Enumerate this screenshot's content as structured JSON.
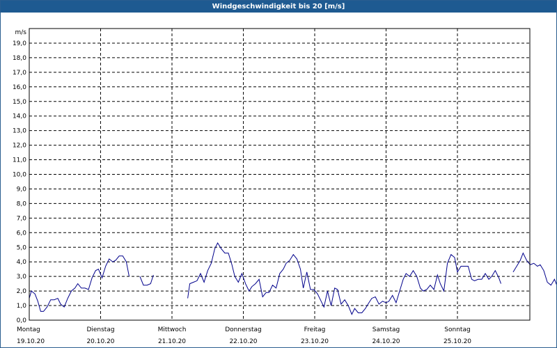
{
  "chart_data": {
    "type": "line",
    "title": "Windgeschwindigkeit bis 20 [m/s]",
    "ylabel": "m/s",
    "ylim": [
      0,
      20
    ],
    "yticks": [
      "0,0",
      "1,0",
      "2,0",
      "3,0",
      "4,0",
      "5,0",
      "6,0",
      "7,0",
      "8,0",
      "9,0",
      "10,0",
      "11,0",
      "12,0",
      "13,0",
      "14,0",
      "15,0",
      "16,0",
      "17,0",
      "18,0",
      "19,0"
    ],
    "days": [
      {
        "name": "Montag",
        "date": "19.10.20"
      },
      {
        "name": "Dienstag",
        "date": "20.10.20"
      },
      {
        "name": "Mittwoch",
        "date": "21.10.20"
      },
      {
        "name": "Donnerstag",
        "date": "22.10.20"
      },
      {
        "name": "Freitag",
        "date": "23.10.20"
      },
      {
        "name": "Samstag",
        "date": "24.10.20"
      },
      {
        "name": "Sonntag",
        "date": "25.10.20"
      }
    ],
    "grid": true,
    "line_color": "#00008b",
    "series": [
      {
        "x_unit": "day",
        "segments": [
          [
            [
              0.0,
              1.5
            ],
            [
              0.03,
              2.0
            ],
            [
              0.08,
              1.8
            ],
            [
              0.12,
              1.3
            ],
            [
              0.16,
              0.6
            ],
            [
              0.2,
              0.6
            ],
            [
              0.25,
              0.9
            ],
            [
              0.3,
              1.4
            ],
            [
              0.35,
              1.4
            ],
            [
              0.4,
              1.5
            ],
            [
              0.44,
              1.1
            ],
            [
              0.49,
              0.9
            ],
            [
              0.54,
              1.5
            ],
            [
              0.59,
              2.0
            ],
            [
              0.64,
              2.2
            ],
            [
              0.68,
              2.5
            ],
            [
              0.73,
              2.2
            ],
            [
              0.78,
              2.2
            ],
            [
              0.83,
              2.1
            ],
            [
              0.88,
              2.9
            ],
            [
              0.93,
              3.4
            ],
            [
              0.97,
              3.5
            ],
            [
              1.02,
              2.9
            ],
            [
              1.07,
              3.7
            ],
            [
              1.12,
              4.2
            ],
            [
              1.17,
              4.0
            ],
            [
              1.21,
              4.1
            ],
            [
              1.26,
              4.4
            ],
            [
              1.31,
              4.4
            ],
            [
              1.36,
              4.0
            ],
            [
              1.4,
              3.0
            ]
          ],
          [
            [
              1.55,
              3.0
            ],
            [
              1.6,
              2.4
            ],
            [
              1.65,
              2.4
            ],
            [
              1.7,
              2.5
            ],
            [
              1.74,
              3.1
            ]
          ],
          [
            [
              2.22,
              1.5
            ],
            [
              2.25,
              2.5
            ],
            [
              2.3,
              2.6
            ],
            [
              2.35,
              2.7
            ],
            [
              2.4,
              3.2
            ],
            [
              2.45,
              2.6
            ],
            [
              2.5,
              3.4
            ],
            [
              2.55,
              3.9
            ],
            [
              2.6,
              4.9
            ],
            [
              2.64,
              5.3
            ],
            [
              2.69,
              4.9
            ],
            [
              2.74,
              4.6
            ],
            [
              2.79,
              4.6
            ],
            [
              2.84,
              3.8
            ],
            [
              2.88,
              3.0
            ],
            [
              2.93,
              2.6
            ],
            [
              2.98,
              3.2
            ],
            [
              3.03,
              2.5
            ],
            [
              3.08,
              2.0
            ],
            [
              3.12,
              2.3
            ],
            [
              3.17,
              2.5
            ],
            [
              3.22,
              2.8
            ],
            [
              3.27,
              1.6
            ],
            [
              3.32,
              1.9
            ],
            [
              3.36,
              1.9
            ],
            [
              3.41,
              2.4
            ],
            [
              3.46,
              2.2
            ],
            [
              3.51,
              3.2
            ],
            [
              3.56,
              3.5
            ],
            [
              3.6,
              3.9
            ],
            [
              3.65,
              4.1
            ],
            [
              3.7,
              4.5
            ],
            [
              3.75,
              4.2
            ],
            [
              3.8,
              3.5
            ],
            [
              3.84,
              2.2
            ],
            [
              3.89,
              3.3
            ],
            [
              3.94,
              2.1
            ],
            [
              3.99,
              2.1
            ],
            [
              4.04,
              1.8
            ],
            [
              4.08,
              1.4
            ],
            [
              4.13,
              0.9
            ],
            [
              4.18,
              2.0
            ],
            [
              4.23,
              1.0
            ],
            [
              4.28,
              2.2
            ],
            [
              4.32,
              2.1
            ],
            [
              4.37,
              1.1
            ],
            [
              4.42,
              1.4
            ],
            [
              4.47,
              1.0
            ],
            [
              4.52,
              0.4
            ],
            [
              4.56,
              0.8
            ],
            [
              4.61,
              0.5
            ],
            [
              4.66,
              0.5
            ],
            [
              4.71,
              0.8
            ],
            [
              4.76,
              1.2
            ],
            [
              4.8,
              1.5
            ],
            [
              4.85,
              1.6
            ],
            [
              4.9,
              1.1
            ],
            [
              4.95,
              1.3
            ],
            [
              5.0,
              1.2
            ],
            [
              5.04,
              1.3
            ],
            [
              5.09,
              1.7
            ],
            [
              5.14,
              1.2
            ],
            [
              5.19,
              2.0
            ],
            [
              5.24,
              2.8
            ],
            [
              5.28,
              3.2
            ],
            [
              5.33,
              3.0
            ],
            [
              5.38,
              3.4
            ],
            [
              5.43,
              3.0
            ],
            [
              5.48,
              2.2
            ],
            [
              5.52,
              2.0
            ],
            [
              5.57,
              2.1
            ],
            [
              5.62,
              2.4
            ],
            [
              5.67,
              2.1
            ],
            [
              5.72,
              3.1
            ],
            [
              5.76,
              2.5
            ],
            [
              5.81,
              2.0
            ],
            [
              5.86,
              3.9
            ],
            [
              5.91,
              4.5
            ],
            [
              5.96,
              4.3
            ],
            [
              6.0,
              3.3
            ],
            [
              6.05,
              3.7
            ],
            [
              6.1,
              3.7
            ],
            [
              6.15,
              3.7
            ],
            [
              6.2,
              2.8
            ],
            [
              6.24,
              2.7
            ],
            [
              6.29,
              2.8
            ],
            [
              6.34,
              2.8
            ],
            [
              6.39,
              3.2
            ],
            [
              6.44,
              2.8
            ],
            [
              6.48,
              3.0
            ],
            [
              6.53,
              3.4
            ],
            [
              6.58,
              2.9
            ],
            [
              6.61,
              2.5
            ]
          ],
          [
            [
              6.78,
              3.3
            ],
            [
              6.83,
              3.7
            ],
            [
              6.88,
              4.1
            ],
            [
              6.92,
              4.6
            ],
            [
              6.97,
              4.1
            ],
            [
              7.02,
              3.8
            ],
            [
              7.07,
              3.9
            ],
            [
              7.12,
              3.7
            ],
            [
              7.16,
              3.8
            ],
            [
              7.21,
              3.4
            ],
            [
              7.26,
              2.6
            ],
            [
              7.31,
              2.4
            ],
            [
              7.36,
              2.8
            ],
            [
              7.4,
              2.3
            ],
            [
              7.45,
              2.0
            ],
            [
              7.5,
              1.8
            ],
            [
              7.55,
              1.4
            ],
            [
              7.6,
              1.4
            ],
            [
              7.64,
              1.9
            ],
            [
              7.69,
              2.3
            ],
            [
              7.74,
              2.2
            ],
            [
              7.78,
              2.0
            ]
          ]
        ]
      }
    ]
  }
}
